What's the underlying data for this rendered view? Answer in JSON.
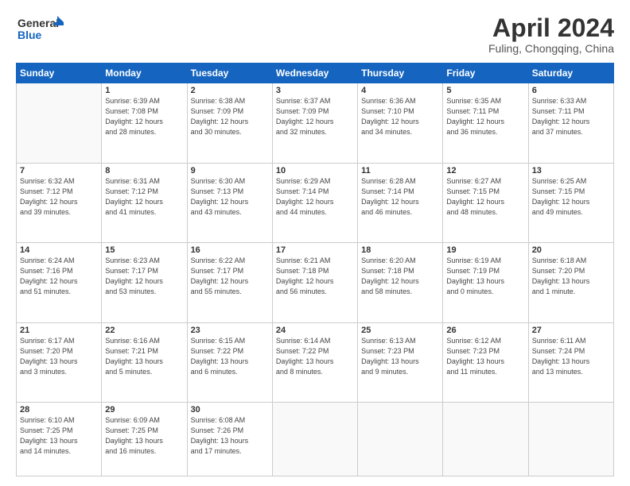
{
  "logo": {
    "general": "General",
    "blue": "Blue"
  },
  "title": "April 2024",
  "subtitle": "Fuling, Chongqing, China",
  "weekdays": [
    "Sunday",
    "Monday",
    "Tuesday",
    "Wednesday",
    "Thursday",
    "Friday",
    "Saturday"
  ],
  "weeks": [
    [
      {
        "day": "",
        "info": ""
      },
      {
        "day": "1",
        "info": "Sunrise: 6:39 AM\nSunset: 7:08 PM\nDaylight: 12 hours\nand 28 minutes."
      },
      {
        "day": "2",
        "info": "Sunrise: 6:38 AM\nSunset: 7:09 PM\nDaylight: 12 hours\nand 30 minutes."
      },
      {
        "day": "3",
        "info": "Sunrise: 6:37 AM\nSunset: 7:09 PM\nDaylight: 12 hours\nand 32 minutes."
      },
      {
        "day": "4",
        "info": "Sunrise: 6:36 AM\nSunset: 7:10 PM\nDaylight: 12 hours\nand 34 minutes."
      },
      {
        "day": "5",
        "info": "Sunrise: 6:35 AM\nSunset: 7:11 PM\nDaylight: 12 hours\nand 36 minutes."
      },
      {
        "day": "6",
        "info": "Sunrise: 6:33 AM\nSunset: 7:11 PM\nDaylight: 12 hours\nand 37 minutes."
      }
    ],
    [
      {
        "day": "7",
        "info": "Sunrise: 6:32 AM\nSunset: 7:12 PM\nDaylight: 12 hours\nand 39 minutes."
      },
      {
        "day": "8",
        "info": "Sunrise: 6:31 AM\nSunset: 7:12 PM\nDaylight: 12 hours\nand 41 minutes."
      },
      {
        "day": "9",
        "info": "Sunrise: 6:30 AM\nSunset: 7:13 PM\nDaylight: 12 hours\nand 43 minutes."
      },
      {
        "day": "10",
        "info": "Sunrise: 6:29 AM\nSunset: 7:14 PM\nDaylight: 12 hours\nand 44 minutes."
      },
      {
        "day": "11",
        "info": "Sunrise: 6:28 AM\nSunset: 7:14 PM\nDaylight: 12 hours\nand 46 minutes."
      },
      {
        "day": "12",
        "info": "Sunrise: 6:27 AM\nSunset: 7:15 PM\nDaylight: 12 hours\nand 48 minutes."
      },
      {
        "day": "13",
        "info": "Sunrise: 6:25 AM\nSunset: 7:15 PM\nDaylight: 12 hours\nand 49 minutes."
      }
    ],
    [
      {
        "day": "14",
        "info": "Sunrise: 6:24 AM\nSunset: 7:16 PM\nDaylight: 12 hours\nand 51 minutes."
      },
      {
        "day": "15",
        "info": "Sunrise: 6:23 AM\nSunset: 7:17 PM\nDaylight: 12 hours\nand 53 minutes."
      },
      {
        "day": "16",
        "info": "Sunrise: 6:22 AM\nSunset: 7:17 PM\nDaylight: 12 hours\nand 55 minutes."
      },
      {
        "day": "17",
        "info": "Sunrise: 6:21 AM\nSunset: 7:18 PM\nDaylight: 12 hours\nand 56 minutes."
      },
      {
        "day": "18",
        "info": "Sunrise: 6:20 AM\nSunset: 7:18 PM\nDaylight: 12 hours\nand 58 minutes."
      },
      {
        "day": "19",
        "info": "Sunrise: 6:19 AM\nSunset: 7:19 PM\nDaylight: 13 hours\nand 0 minutes."
      },
      {
        "day": "20",
        "info": "Sunrise: 6:18 AM\nSunset: 7:20 PM\nDaylight: 13 hours\nand 1 minute."
      }
    ],
    [
      {
        "day": "21",
        "info": "Sunrise: 6:17 AM\nSunset: 7:20 PM\nDaylight: 13 hours\nand 3 minutes."
      },
      {
        "day": "22",
        "info": "Sunrise: 6:16 AM\nSunset: 7:21 PM\nDaylight: 13 hours\nand 5 minutes."
      },
      {
        "day": "23",
        "info": "Sunrise: 6:15 AM\nSunset: 7:22 PM\nDaylight: 13 hours\nand 6 minutes."
      },
      {
        "day": "24",
        "info": "Sunrise: 6:14 AM\nSunset: 7:22 PM\nDaylight: 13 hours\nand 8 minutes."
      },
      {
        "day": "25",
        "info": "Sunrise: 6:13 AM\nSunset: 7:23 PM\nDaylight: 13 hours\nand 9 minutes."
      },
      {
        "day": "26",
        "info": "Sunrise: 6:12 AM\nSunset: 7:23 PM\nDaylight: 13 hours\nand 11 minutes."
      },
      {
        "day": "27",
        "info": "Sunrise: 6:11 AM\nSunset: 7:24 PM\nDaylight: 13 hours\nand 13 minutes."
      }
    ],
    [
      {
        "day": "28",
        "info": "Sunrise: 6:10 AM\nSunset: 7:25 PM\nDaylight: 13 hours\nand 14 minutes."
      },
      {
        "day": "29",
        "info": "Sunrise: 6:09 AM\nSunset: 7:25 PM\nDaylight: 13 hours\nand 16 minutes."
      },
      {
        "day": "30",
        "info": "Sunrise: 6:08 AM\nSunset: 7:26 PM\nDaylight: 13 hours\nand 17 minutes."
      },
      {
        "day": "",
        "info": ""
      },
      {
        "day": "",
        "info": ""
      },
      {
        "day": "",
        "info": ""
      },
      {
        "day": "",
        "info": ""
      }
    ]
  ]
}
